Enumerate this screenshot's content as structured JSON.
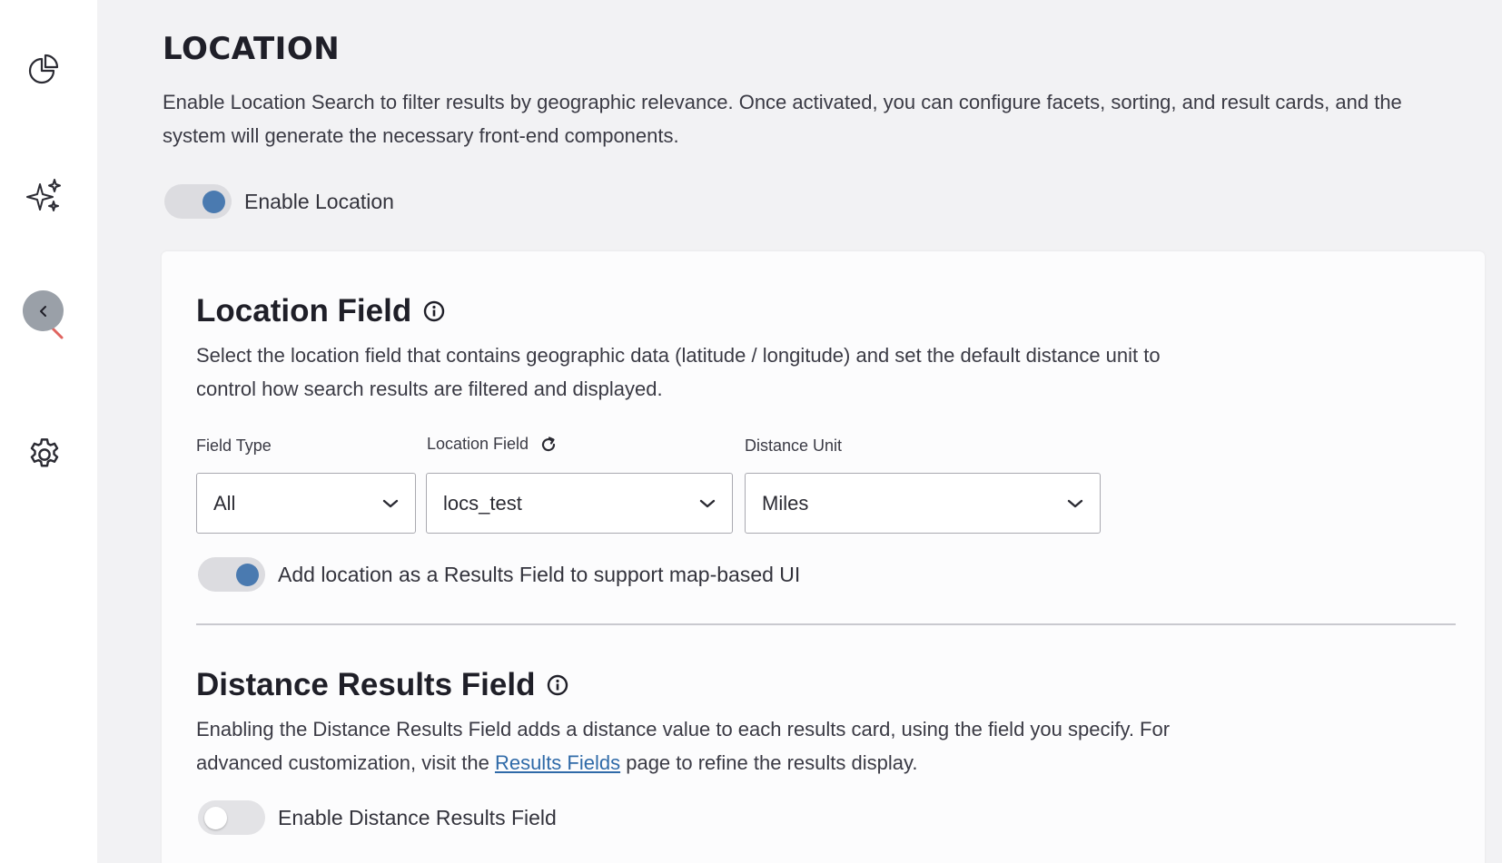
{
  "sidebar": {
    "icons": [
      "pie-chart-icon",
      "sparkles-icon",
      "chevron-left-icon",
      "search-icon",
      "gear-icon"
    ]
  },
  "page": {
    "title": "LOCATION",
    "description": "Enable Location Search to filter results by geographic relevance. Once activated, you can configure facets, sorting, and result cards, and the system will generate the necessary front-end components.",
    "enable_location_label": "Enable Location",
    "enable_location_on": true
  },
  "location_field_section": {
    "title": "Location Field",
    "description": "Select the location field that contains geographic data (latitude / longitude) and set the default distance unit to control how search results are filtered and displayed.",
    "field_type": {
      "label": "Field Type",
      "value": "All"
    },
    "location_field": {
      "label": "Location Field",
      "value": "locs_test"
    },
    "distance_unit": {
      "label": "Distance Unit",
      "value": "Miles"
    },
    "add_results_field_label": "Add location as a Results Field to support map-based UI",
    "add_results_field_on": true
  },
  "distance_section": {
    "title": "Distance Results Field",
    "description_before": "Enabling the Distance Results Field adds a distance value to each results card, using the field you specify. For advanced customization, visit the ",
    "link_text": "Results Fields",
    "description_after": " page to refine the results display.",
    "enable_label": "Enable Distance Results Field",
    "enable_on": false
  },
  "colors": {
    "accent": "#4a7ab0",
    "link": "#2f6aa8",
    "sidebar_bg": "#ffffff",
    "page_bg": "#f2f2f4"
  }
}
